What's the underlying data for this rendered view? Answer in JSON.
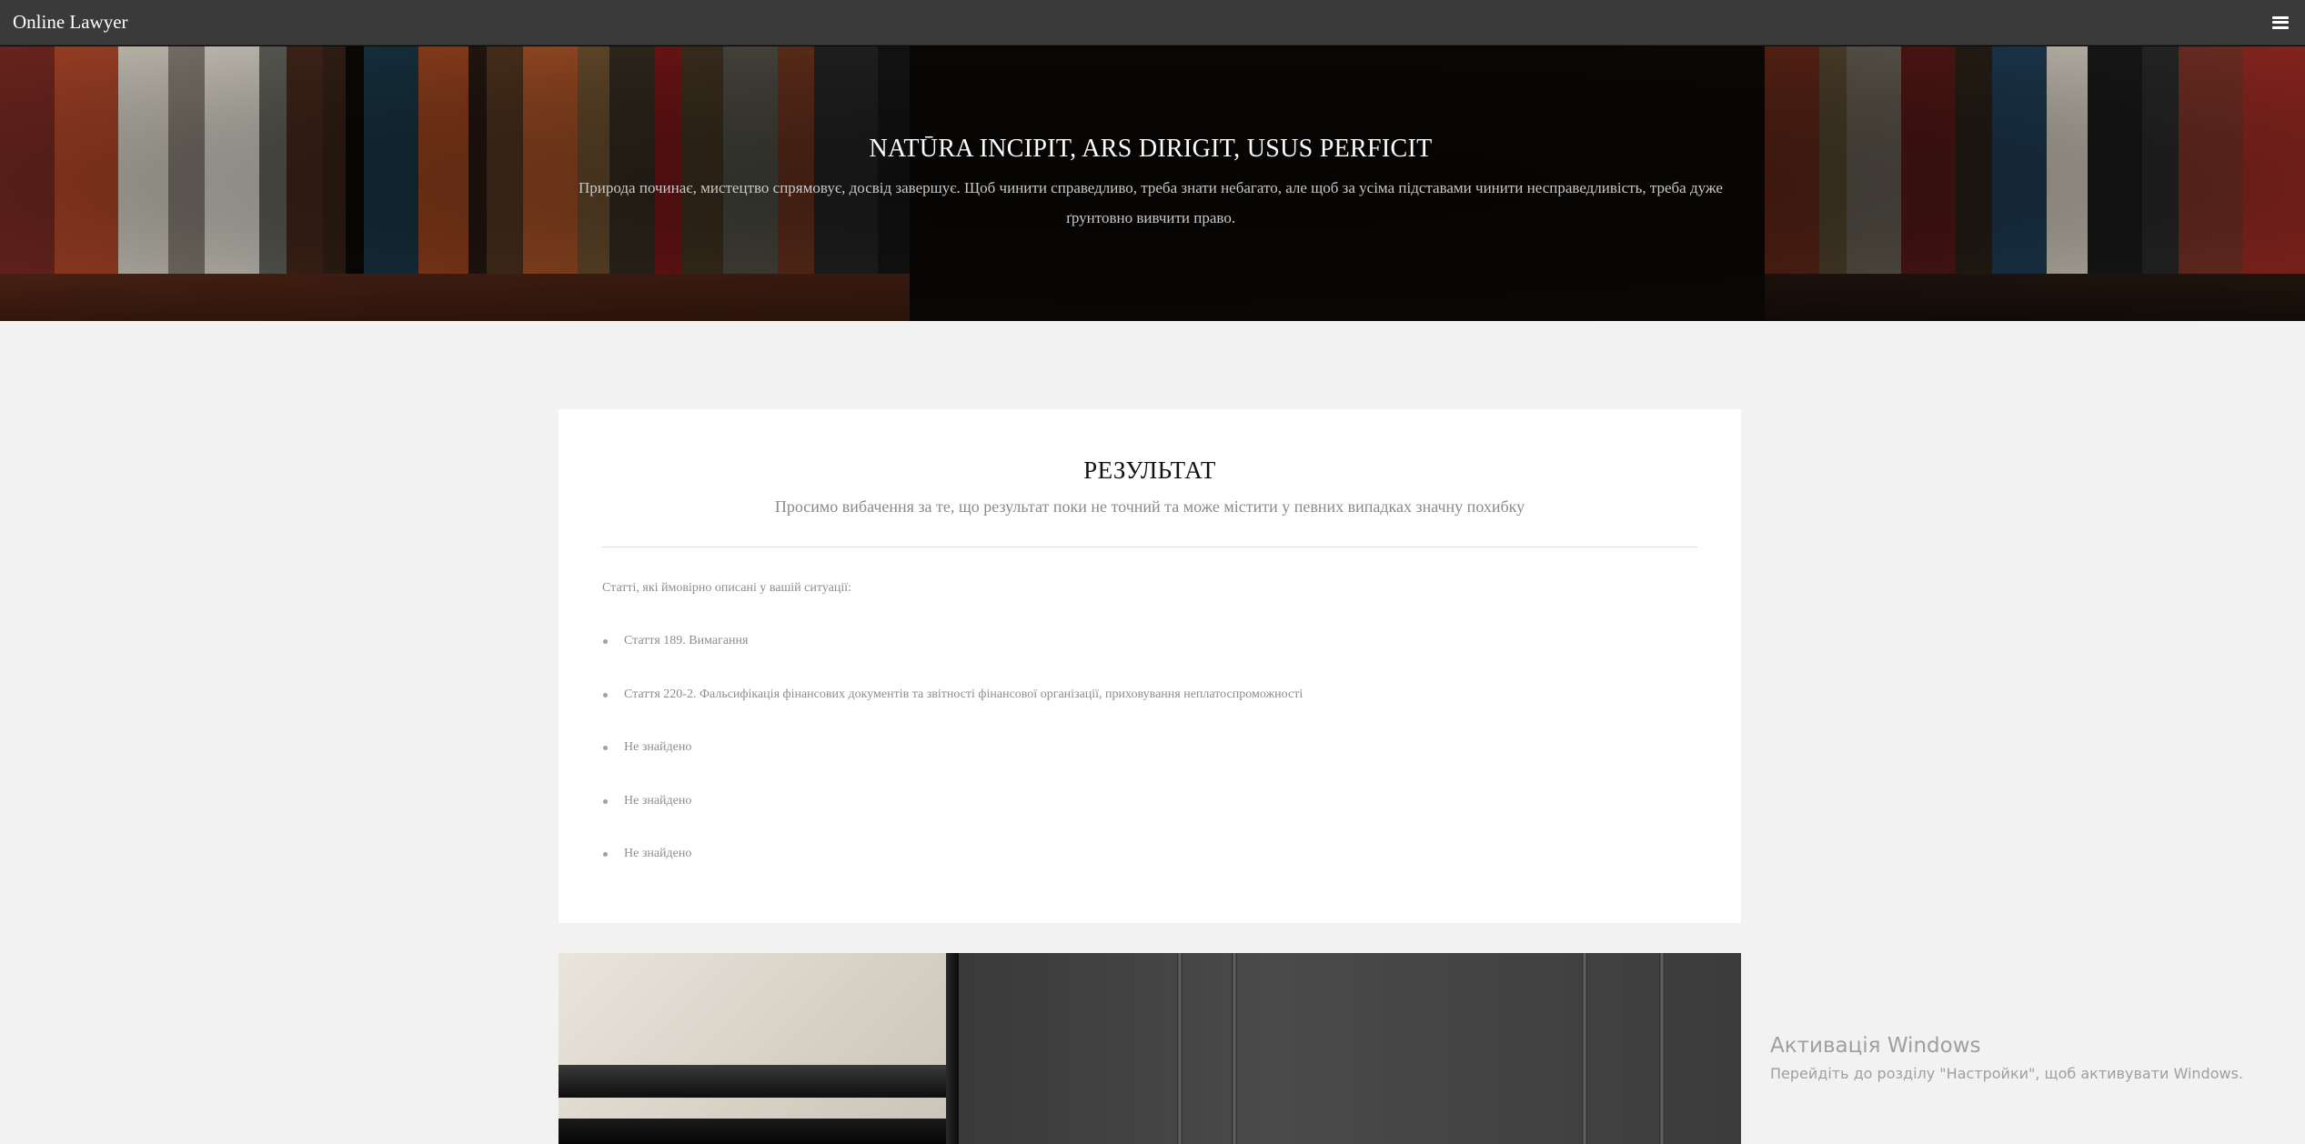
{
  "navbar": {
    "brand": "Online Lawyer",
    "menu_icon": "hamburger-menu-icon"
  },
  "hero": {
    "title": "NATŪRA INCIPIT, ARS DIRIGIT, USUS PERFICIT",
    "subtitle": "Природа починає, мистецтво спрямовує, досвід завершує. Щоб чинити справедливо, треба знати небагато, але щоб за усіма підставами чинити несправедливість, треба дуже ґрунтовно вивчити право."
  },
  "result": {
    "title": "РЕЗУЛЬТАТ",
    "subtitle": "Просимо вибачення за те, що результат поки не точний та може містити у певних випадках значну похибку",
    "intro": "Статті, які ймовірно описані у вашій ситуації:",
    "articles": [
      "Стаття 189. Вимагання",
      "Стаття 220-2. Фальсифікація фінансових документів та звітності фінансової організації, приховування неплатоспроможності",
      "Не знайдено",
      "Не знайдено",
      "Не знайдено"
    ]
  },
  "watermark": {
    "title": "Активація Windows",
    "text": "Перейдіть до розділу \"Настройки\", щоб активувати Windows."
  },
  "colors": {
    "navbar_bg": "#3a3a3a",
    "page_bg": "#f2f2f2",
    "card_bg": "#ffffff"
  }
}
